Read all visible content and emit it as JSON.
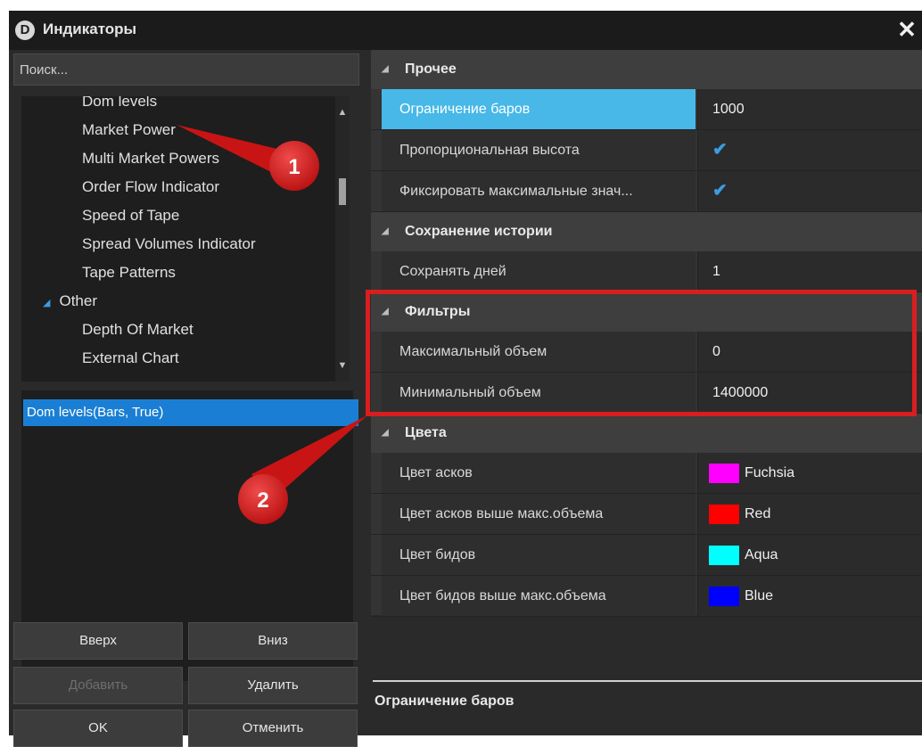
{
  "window": {
    "title": "Индикаторы",
    "close_glyph": "✕"
  },
  "search": {
    "placeholder": "Поиск..."
  },
  "tree": {
    "items": [
      {
        "label": "Dom levels",
        "level": 2
      },
      {
        "label": "Market Power",
        "level": 2
      },
      {
        "label": "Multi Market Powers",
        "level": 2
      },
      {
        "label": "Order Flow Indicator",
        "level": 2
      },
      {
        "label": "Speed of Tape",
        "level": 2
      },
      {
        "label": "Spread Volumes Indicator",
        "level": 2
      },
      {
        "label": "Tape Patterns",
        "level": 2
      },
      {
        "label": "Other",
        "level": 1
      },
      {
        "label": "Depth Of Market",
        "level": 2
      },
      {
        "label": "External Chart",
        "level": 2
      }
    ]
  },
  "selected_indicators": [
    "Dom levels(Bars, True)"
  ],
  "buttons": {
    "up": "Вверх",
    "down": "Вниз",
    "add": "Добавить",
    "delete": "Удалить",
    "ok": "OK",
    "cancel": "Отменить"
  },
  "properties": {
    "categories": [
      {
        "name": "Прочее",
        "rows": [
          {
            "name": "Ограничение баров",
            "value": "1000"
          },
          {
            "name": "Пропорциональная высота",
            "value": "✔"
          },
          {
            "name": "Фиксировать максимальные знач...",
            "value": "✔"
          }
        ]
      },
      {
        "name": "Сохранение истории",
        "rows": [
          {
            "name": "Сохранять дней",
            "value": "1"
          }
        ]
      },
      {
        "name": "Фильтры",
        "rows": [
          {
            "name": "Максимальный объем",
            "value": "0"
          },
          {
            "name": "Минимальный объем",
            "value": "1400000"
          }
        ]
      },
      {
        "name": "Цвета",
        "rows": [
          {
            "name": "Цвет асков",
            "value": "Fuchsia",
            "color": "#ff00ff"
          },
          {
            "name": "Цвет асков выше макс.объема",
            "value": "Red",
            "color": "#ff0000"
          },
          {
            "name": "Цвет бидов",
            "value": "Aqua",
            "color": "#00ffff"
          },
          {
            "name": "Цвет бидов выше макс.объема",
            "value": "Blue",
            "color": "#0000ff"
          }
        ]
      }
    ]
  },
  "description": {
    "title": "Ограничение баров"
  },
  "annotations": {
    "marker1": "1",
    "marker2": "2",
    "color": "#d81e1e"
  },
  "accent_colors": {
    "selection": "#1a7fd4",
    "active_property": "#47b8e8",
    "check": "#3d9be0"
  }
}
